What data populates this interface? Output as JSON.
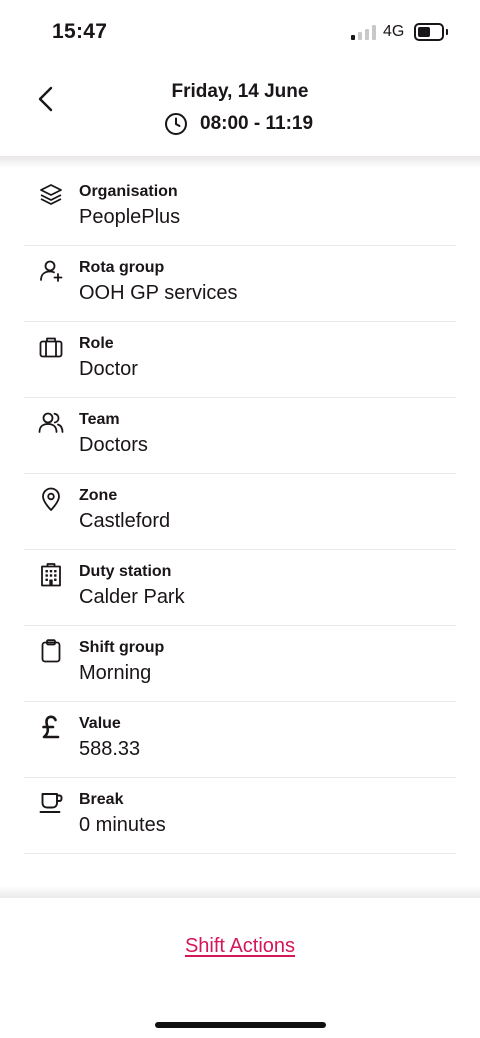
{
  "status_bar": {
    "time": "15:47",
    "network": "4G",
    "signal_bars_filled": 1,
    "signal_bars_total": 4,
    "battery_level_fraction": 0.4
  },
  "header": {
    "date": "Friday, 14 June",
    "time_range": "08:00 - 11:19",
    "back_icon": "chevron-left-icon",
    "time_icon": "clock-icon"
  },
  "details": [
    {
      "key": "organisation",
      "icon": "layers-icon",
      "label": "Organisation",
      "value": "PeoplePlus"
    },
    {
      "key": "rota-group",
      "icon": "user-add-icon",
      "label": "Rota group",
      "value": "OOH GP services"
    },
    {
      "key": "role",
      "icon": "briefcase-icon",
      "label": "Role",
      "value": "Doctor"
    },
    {
      "key": "team",
      "icon": "users-icon",
      "label": "Team",
      "value": "Doctors"
    },
    {
      "key": "zone",
      "icon": "location-pin-icon",
      "label": "Zone",
      "value": "Castleford"
    },
    {
      "key": "duty-station",
      "icon": "building-icon",
      "label": "Duty station",
      "value": "Calder Park"
    },
    {
      "key": "shift-group",
      "icon": "clipboard-icon",
      "label": "Shift group",
      "value": "Morning"
    },
    {
      "key": "value",
      "icon": "pound-icon",
      "label": "Value",
      "value": "588.33"
    },
    {
      "key": "break",
      "icon": "coffee-cup-icon",
      "label": "Break",
      "value": "0 minutes"
    }
  ],
  "footer": {
    "shift_actions_label": "Shift Actions"
  },
  "colors": {
    "accent": "#d4165a",
    "text": "#1a1518",
    "divider": "#ebe8ea"
  }
}
